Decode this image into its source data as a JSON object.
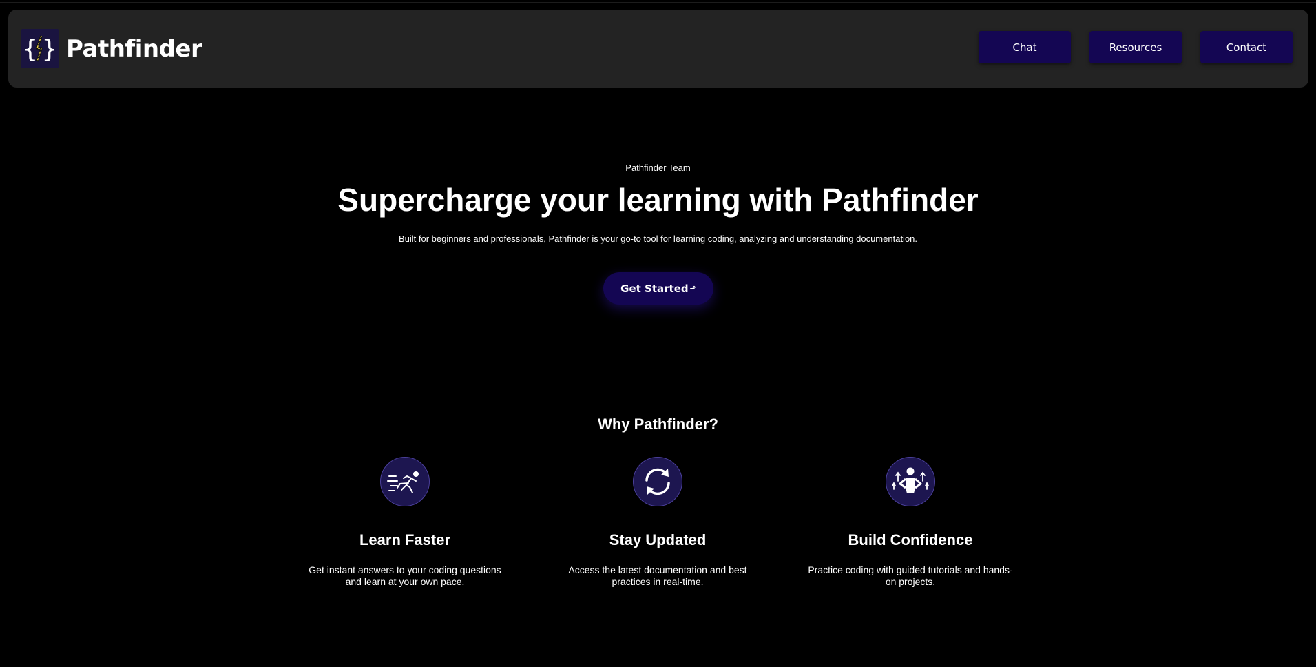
{
  "header": {
    "brand_name": "Pathfinder",
    "logo_icon": "code-braces-lightning-icon",
    "nav": [
      {
        "label": "Chat"
      },
      {
        "label": "Resources"
      },
      {
        "label": "Contact"
      }
    ]
  },
  "hero": {
    "eyebrow": "Pathfinder Team",
    "title": "Supercharge your learning with Pathfinder",
    "subtitle": "Built for beginners and professionals, Pathfinder is your go-to tool for learning coding, analyzing and understanding documentation.",
    "cta_label": "Get Started",
    "cta_icon": "arrow-icon"
  },
  "why": {
    "title": "Why Pathfinder?",
    "features": [
      {
        "icon": "running-person-icon",
        "title": "Learn Faster",
        "description": "Get instant answers to your coding questions and learn at your own pace."
      },
      {
        "icon": "refresh-icon",
        "title": "Stay Updated",
        "description": "Access the latest documentation and best practices in real-time."
      },
      {
        "icon": "confident-person-icon",
        "title": "Build Confidence",
        "description": "Practice coding with guided tutorials and hands-on projects."
      }
    ]
  },
  "colors": {
    "background": "#000000",
    "navbar": "#232323",
    "accent": "#140653",
    "icon_circle": "#1d1650"
  }
}
